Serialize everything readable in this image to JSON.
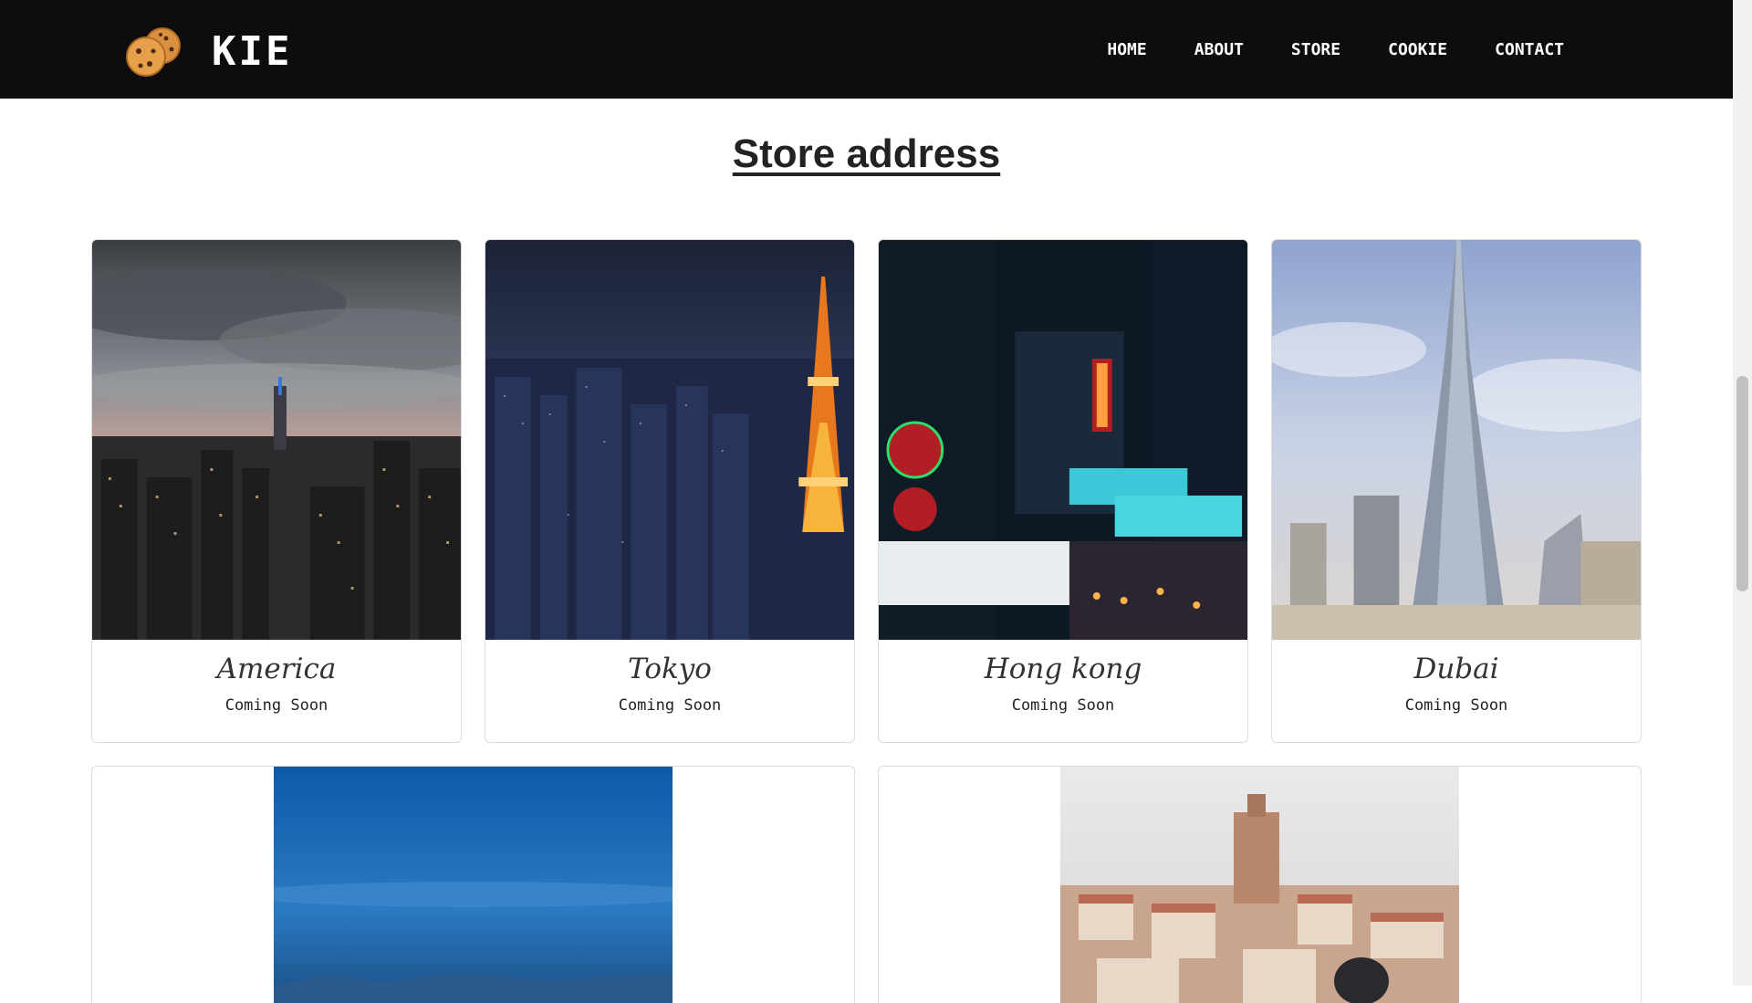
{
  "brand": {
    "name": "KIE",
    "logo_icon": "cookie-icon"
  },
  "nav": {
    "items": [
      {
        "label": "HOME"
      },
      {
        "label": "ABOUT"
      },
      {
        "label": "STORE"
      },
      {
        "label": "COOKIE"
      },
      {
        "label": "CONTACT"
      }
    ]
  },
  "section": {
    "title": "Store address"
  },
  "stores": [
    {
      "city": "America",
      "status": "Coming Soon",
      "image": "new-york-skyline-photo"
    },
    {
      "city": "Tokyo",
      "status": "Coming Soon",
      "image": "tokyo-tower-night-photo"
    },
    {
      "city": "Hong kong",
      "status": "Coming Soon",
      "image": "hong-kong-neon-street-photo"
    },
    {
      "city": "Dubai",
      "status": "Coming Soon",
      "image": "burj-khalifa-photo"
    }
  ],
  "stores_row2": [
    {
      "image": "blue-sky-mountain-photo"
    },
    {
      "image": "european-city-rooftops-photo"
    }
  ],
  "colors": {
    "navbar": "#0d0d0d",
    "text": "#222222",
    "border": "#dcdcdc"
  }
}
